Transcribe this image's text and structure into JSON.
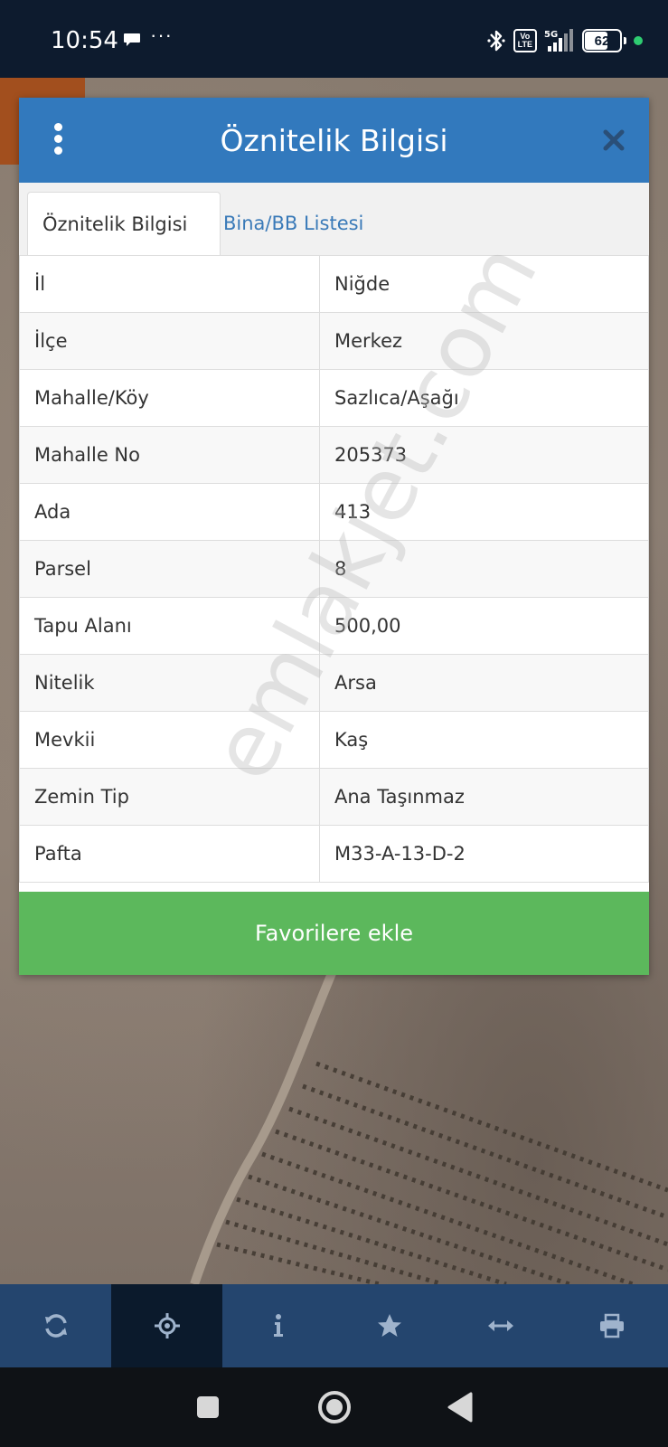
{
  "status_bar": {
    "time": "10:54",
    "more": "···",
    "volte_line1": "Vo",
    "volte_line2": "LTE",
    "network": "5G",
    "battery": "62"
  },
  "dialog": {
    "title": "Öznitelik Bilgisi",
    "tabs": [
      {
        "label": "Öznitelik Bilgisi",
        "active": true
      },
      {
        "label": "Bina/BB Listesi",
        "active": false
      }
    ],
    "rows": [
      {
        "key": "İl",
        "value": "Niğde"
      },
      {
        "key": "İlçe",
        "value": "Merkez"
      },
      {
        "key": "Mahalle/Köy",
        "value": "Sazlıca/Aşağı"
      },
      {
        "key": "Mahalle No",
        "value": "205373"
      },
      {
        "key": "Ada",
        "value": "413"
      },
      {
        "key": "Parsel",
        "value": "8"
      },
      {
        "key": "Tapu Alanı",
        "value": "500,00"
      },
      {
        "key": "Nitelik",
        "value": "Arsa"
      },
      {
        "key": "Mevkii",
        "value": "Kaş"
      },
      {
        "key": "Zemin Tip",
        "value": "Ana Taşınmaz"
      },
      {
        "key": "Pafta",
        "value": "M33-A-13-D-2"
      }
    ],
    "favorite_button": "Favorilere ekle"
  },
  "watermark": "emlakjet.com",
  "toolbar": {
    "items": [
      "refresh-icon",
      "locate-icon",
      "info-icon",
      "star-icon",
      "measure-icon",
      "print-icon"
    ],
    "active": "locate-icon"
  },
  "colors": {
    "header": "#3279bd",
    "favorite": "#5cb85c",
    "toolbar": "#24456e",
    "toolbar_active": "#0b1a2c",
    "tab_link": "#3a7ab8"
  }
}
